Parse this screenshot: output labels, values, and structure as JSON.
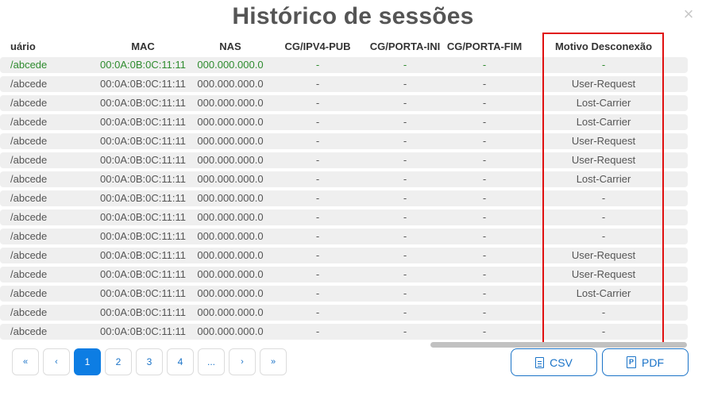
{
  "modal": {
    "title": "Histórico de sessões",
    "close_icon": "×"
  },
  "table": {
    "headers": {
      "usuario": "uário",
      "mac": "MAC",
      "nas": "NAS",
      "ipv4": "CG/IPV4-PUB",
      "porta_ini": "CG/PORTA-INI",
      "porta_fim": "CG/PORTA-FIM",
      "motivo": "Motivo Desconexão"
    },
    "rows": [
      {
        "usuario": "/abcede",
        "mac": "00:0A:0B:0C:11:11",
        "nas": "000.000.000.0",
        "ipv4": "-",
        "porta_ini": "-",
        "porta_fim": "-",
        "motivo": "-"
      },
      {
        "usuario": "/abcede",
        "mac": "00:0A:0B:0C:11:11",
        "nas": "000.000.000.0",
        "ipv4": "-",
        "porta_ini": "-",
        "porta_fim": "-",
        "motivo": "User-Request"
      },
      {
        "usuario": "/abcede",
        "mac": "00:0A:0B:0C:11:11",
        "nas": "000.000.000.0",
        "ipv4": "-",
        "porta_ini": "-",
        "porta_fim": "-",
        "motivo": "Lost-Carrier"
      },
      {
        "usuario": "/abcede",
        "mac": "00:0A:0B:0C:11:11",
        "nas": "000.000.000.0",
        "ipv4": "-",
        "porta_ini": "-",
        "porta_fim": "-",
        "motivo": "Lost-Carrier"
      },
      {
        "usuario": "/abcede",
        "mac": "00:0A:0B:0C:11:11",
        "nas": "000.000.000.0",
        "ipv4": "-",
        "porta_ini": "-",
        "porta_fim": "-",
        "motivo": "User-Request"
      },
      {
        "usuario": "/abcede",
        "mac": "00:0A:0B:0C:11:11",
        "nas": "000.000.000.0",
        "ipv4": "-",
        "porta_ini": "-",
        "porta_fim": "-",
        "motivo": "User-Request"
      },
      {
        "usuario": "/abcede",
        "mac": "00:0A:0B:0C:11:11",
        "nas": "000.000.000.0",
        "ipv4": "-",
        "porta_ini": "-",
        "porta_fim": "-",
        "motivo": "Lost-Carrier"
      },
      {
        "usuario": "/abcede",
        "mac": "00:0A:0B:0C:11:11",
        "nas": "000.000.000.0",
        "ipv4": "-",
        "porta_ini": "-",
        "porta_fim": "-",
        "motivo": "-"
      },
      {
        "usuario": "/abcede",
        "mac": "00:0A:0B:0C:11:11",
        "nas": "000.000.000.0",
        "ipv4": "-",
        "porta_ini": "-",
        "porta_fim": "-",
        "motivo": "-"
      },
      {
        "usuario": "/abcede",
        "mac": "00:0A:0B:0C:11:11",
        "nas": "000.000.000.0",
        "ipv4": "-",
        "porta_ini": "-",
        "porta_fim": "-",
        "motivo": "-"
      },
      {
        "usuario": "/abcede",
        "mac": "00:0A:0B:0C:11:11",
        "nas": "000.000.000.0",
        "ipv4": "-",
        "porta_ini": "-",
        "porta_fim": "-",
        "motivo": "User-Request"
      },
      {
        "usuario": "/abcede",
        "mac": "00:0A:0B:0C:11:11",
        "nas": "000.000.000.0",
        "ipv4": "-",
        "porta_ini": "-",
        "porta_fim": "-",
        "motivo": "User-Request"
      },
      {
        "usuario": "/abcede",
        "mac": "00:0A:0B:0C:11:11",
        "nas": "000.000.000.0",
        "ipv4": "-",
        "porta_ini": "-",
        "porta_fim": "-",
        "motivo": "Lost-Carrier"
      },
      {
        "usuario": "/abcede",
        "mac": "00:0A:0B:0C:11:11",
        "nas": "000.000.000.0",
        "ipv4": "-",
        "porta_ini": "-",
        "porta_fim": "-",
        "motivo": "-"
      },
      {
        "usuario": "/abcede",
        "mac": "00:0A:0B:0C:11:11",
        "nas": "000.000.000.0",
        "ipv4": "-",
        "porta_ini": "-",
        "porta_fim": "-",
        "motivo": "-"
      }
    ]
  },
  "pagination": {
    "first": "«",
    "prev": "‹",
    "pages": [
      "1",
      "2",
      "3",
      "4"
    ],
    "active_page": "1",
    "ellipsis": "...",
    "next": "›",
    "last": "»"
  },
  "export": {
    "csv_label": "CSV",
    "pdf_label": "PDF",
    "csv_icon": "document-icon",
    "pdf_icon": "pdf-icon",
    "pdf_icon_glyph": "P"
  },
  "colors": {
    "accent": "#0d7de3",
    "highlight_row_text": "#2e8b2e",
    "annotation_box": "#e01010"
  }
}
